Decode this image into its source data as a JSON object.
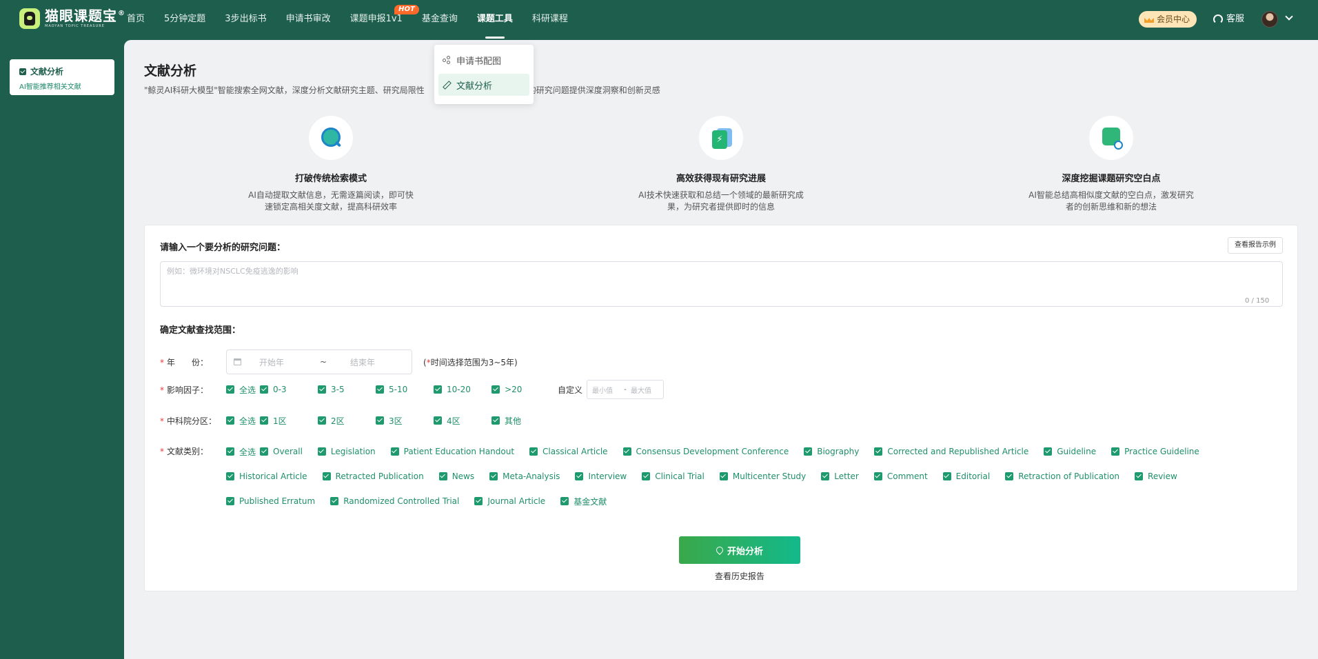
{
  "header": {
    "logo_title": "猫眼课题宝",
    "logo_registered": "®",
    "logo_subtitle": "MAOYAN TOPIC TREASURE",
    "nav": [
      {
        "label": "首页"
      },
      {
        "label": "5分钟定题"
      },
      {
        "label": "3步出标书"
      },
      {
        "label": "申请书审改"
      },
      {
        "label": "课题申报1v1",
        "badge": "HOT"
      },
      {
        "label": "基金查询"
      },
      {
        "label": "课题工具",
        "active": true
      },
      {
        "label": "科研课程"
      }
    ],
    "vip_label": "会员中心",
    "service_label": "客服"
  },
  "dropdown": {
    "items": [
      {
        "label": "申请书配图",
        "icon": "share-icon"
      },
      {
        "label": "文献分析",
        "icon": "pen-icon",
        "active": true
      }
    ]
  },
  "sidebar": {
    "item_title": "文献分析",
    "item_desc": "AI智能推荐相关文献"
  },
  "main": {
    "title": "文献分析",
    "description_left": "\"鲸灵AI科研大模型\"智能搜索全网文献，深度分析文献研究主题、研究局限性",
    "description_right": "的研究问题提供深度洞察和创新灵感",
    "features": [
      {
        "icon": "ai-search-icon",
        "title": "打破传统检索模式",
        "desc": "AI自动提取文献信息，无需逐篇阅读，即可快速锁定高相关度文献，提高科研效率"
      },
      {
        "icon": "fast-doc-icon",
        "title": "高效获得现有研究进展",
        "desc": "AI技术快速获取和总结一个领域的最新研究成果，为研究者提供即时的信息"
      },
      {
        "icon": "chart-search-icon",
        "title": "深度挖掘课题研究空白点",
        "desc": "AI智能总结高相似度文献的空白点，激发研究者的创新思维和新的想法"
      }
    ]
  },
  "form": {
    "question_label": "请输入一个要分析的研究问题：",
    "example_button": "查看报告示例",
    "question_placeholder": "例如：微环境对NSCLC免疫逃逸的影响",
    "question_count": "0 / 150",
    "range_label": "确定文献查找范围：",
    "year": {
      "label": "年　　份：",
      "start_placeholder": "开始年",
      "separator": "~",
      "end_placeholder": "结束年",
      "hint_prefix": "(",
      "hint_star": "*",
      "hint_text": "时间选择范围为3~5年)"
    },
    "impact": {
      "label": "影响因子：",
      "options": [
        "全选",
        "0-3",
        "3-5",
        "5-10",
        "10-20",
        ">20"
      ],
      "custom_label": "自定义",
      "min_placeholder": "最小值",
      "dash": "-",
      "max_placeholder": "最大值"
    },
    "cas": {
      "label": "中科院分区：",
      "options": [
        "全选",
        "1区",
        "2区",
        "3区",
        "4区",
        "其他"
      ]
    },
    "doc_type": {
      "label": "文献类别：",
      "options": [
        "全选",
        "Overall",
        "Legislation",
        "Patient Education Handout",
        "Classical Article",
        "Consensus Development Conference",
        "Biography",
        "Corrected and Republished Article",
        "Guideline",
        "Practice Guideline",
        "Historical Article",
        "Retracted Publication",
        "News",
        "Meta-Analysis",
        "Interview",
        "Clinical Trial",
        "Multicenter Study",
        "Letter",
        "Comment",
        "Editorial",
        "Retraction of Publication",
        "Review",
        "Published Erratum",
        "Randomized Controlled Trial",
        "Journal Article",
        "基金文献"
      ]
    },
    "start_button": "开始分析",
    "history_link": "查看历史报告"
  },
  "colors": {
    "brand": "#1e5e4c",
    "accent": "#1e9a6e",
    "button_gradient_start": "#3aa84a",
    "button_gradient_end": "#13b98b",
    "hot": "#ff6a2a"
  }
}
